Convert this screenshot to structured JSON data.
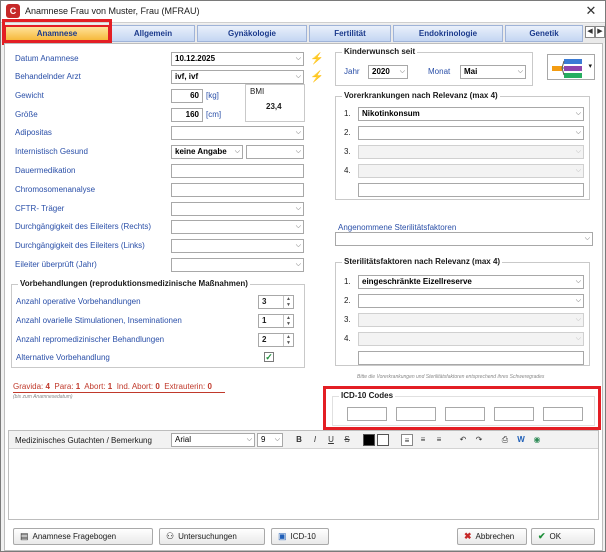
{
  "window": {
    "title": "Anamnese Frau von Muster, Frau (MFRAU)",
    "close_glyph": "✕",
    "app_icon_letter": "C"
  },
  "tabs": [
    {
      "label": "Anamnese",
      "active": true
    },
    {
      "label": "Allgemein"
    },
    {
      "label": "Gynäkologie"
    },
    {
      "label": "Fertilität"
    },
    {
      "label": "Endokrinologie"
    },
    {
      "label": "Genetik"
    }
  ],
  "tab_nav": {
    "prev": "◀",
    "next": "▶"
  },
  "left": {
    "datum_label": "Datum Anamnese",
    "datum_value": "10.12.2025",
    "arzt_label": "Behandelnder Arzt",
    "arzt_value": "ivf, ivf",
    "gewicht_label": "Gewicht",
    "gewicht_value": "60",
    "gewicht_unit": "[kg]",
    "groesse_label": "Größe",
    "groesse_value": "160",
    "groesse_unit": "[cm]",
    "bmi_label": "BMI",
    "bmi_value": "23,4",
    "adipositas_label": "Adipositas",
    "internistisch_label": "Internistisch Gesund",
    "internistisch_value": "keine Angabe",
    "dauermedikation_label": "Dauermedikation",
    "chromosomen_label": "Chromosomenanalyse",
    "cftr_label": "CFTR- Träger",
    "eileiter_rechts_label": "Durchgängigkeit des Eileiters (Rechts)",
    "eileiter_links_label": "Durchgängigkeit des Eileiters (Links)",
    "eileiter_jahr_label": "Eileiter überprüft (Jahr)"
  },
  "vorbehandlungen": {
    "title": "Vorbehandlungen (reproduktionsmedizinische Maßnahmen)",
    "operative_label": "Anzahl operative Vorbehandlungen",
    "operative_value": "3",
    "ovarielle_label": "Anzahl ovarielle Stimulationen, Inseminationen",
    "ovarielle_value": "1",
    "repro_label": "Anzahl repromedizinischer Behandlungen",
    "repro_value": "2",
    "alternative_label": "Alternative Vorbehandlung",
    "alternative_checked": true
  },
  "gravida": {
    "gravida_label": "Gravida:",
    "gravida_value": "4",
    "para_label": "Para:",
    "para_value": "1",
    "abort_label": "Abort:",
    "abort_value": "1",
    "ind_abort_label": "Ind. Abort:",
    "ind_abort_value": "0",
    "extrauterin_label": "Extrauterin:",
    "extrauterin_value": "0",
    "note": "(bis zum Anamnesedatum)"
  },
  "kinderwunsch": {
    "title": "Kinderwunsch seit",
    "jahr_label": "Jahr",
    "jahr_value": "2020",
    "monat_label": "Monat",
    "monat_value": "Mai"
  },
  "vorerkrankungen": {
    "title": "Vorerkrankungen nach Relevanz (max 4)",
    "items": [
      {
        "num": "1.",
        "value": "Nikotinkonsum"
      },
      {
        "num": "2.",
        "value": ""
      },
      {
        "num": "3.",
        "value": ""
      },
      {
        "num": "4.",
        "value": ""
      }
    ]
  },
  "angenommene": {
    "label": "Angenommene Sterilitätsfaktoren"
  },
  "sterilitaet": {
    "title": "Sterilitätsfaktoren nach Relevanz (max 4)",
    "items": [
      {
        "num": "1.",
        "value": "eingeschränkte Eizellreserve"
      },
      {
        "num": "2.",
        "value": ""
      },
      {
        "num": "3.",
        "value": ""
      },
      {
        "num": "4.",
        "value": ""
      }
    ],
    "note": "Bitte die Vorerkrankungen und Sterilitätsfaktoren entsprechend ihres Schweregrades"
  },
  "icd": {
    "title": "ICD-10 Codes",
    "codes": [
      "",
      "",
      "",
      "",
      ""
    ]
  },
  "editor": {
    "label": "Medizinisches Gutachten / Bemerkung",
    "font_value": "Arial",
    "size_value": "9",
    "bold": "B",
    "italic": "I",
    "underline": "U",
    "strike": "S"
  },
  "buttons": {
    "fragebogen": "Anamnese Fragebogen",
    "untersuchungen": "Untersuchungen",
    "icd10": "ICD-10",
    "abbrechen": "Abbrechen",
    "ok": "OK"
  },
  "colors": {
    "accent_red": "#e31e24",
    "tab_blue": "#1b3a8c",
    "label_blue": "#2a4fa8",
    "bolt": "#f2b31b"
  }
}
